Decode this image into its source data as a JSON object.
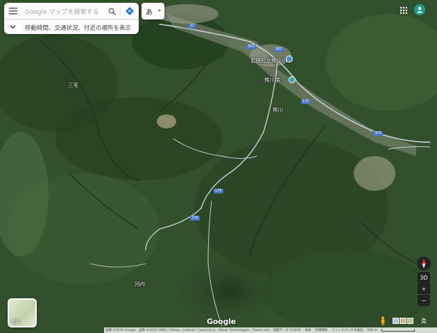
{
  "search": {
    "placeholder": "Google マップを検索する"
  },
  "hint": {
    "text": "移動時間、交通状況、付近の場所を表示"
  },
  "language_button": {
    "label": "あ"
  },
  "labels": {
    "sanbo": "三宅",
    "school": "若狭町立熊川小",
    "kumagawa_shuku": "熊川宿",
    "kumagawa": "熊川",
    "kawachi": "河内"
  },
  "route_shields": [
    "27",
    "303",
    "303",
    "133",
    "303",
    "135",
    "135"
  ],
  "layer": {
    "label": "地図"
  },
  "controls": {
    "three_d": "3D",
    "zoom_in": "+",
    "zoom_out": "−"
  },
  "footer": {
    "imagery": "画像 ©2019 Google、画像 ©2019 CNES / Airbus、Landsat / Copernicus、Maxar Technologies、Planet.com、地図データ ©2019",
    "country": "日本",
    "terms": "利用規約",
    "feedback": "フィードバックの送信",
    "scale": "500 m"
  },
  "brand": {
    "logo": "Google"
  },
  "icons": [
    "menu-icon",
    "search-icon",
    "directions-icon",
    "apps-icon",
    "account-icon",
    "chevron-down-icon",
    "compass-icon",
    "pegman-icon"
  ]
}
